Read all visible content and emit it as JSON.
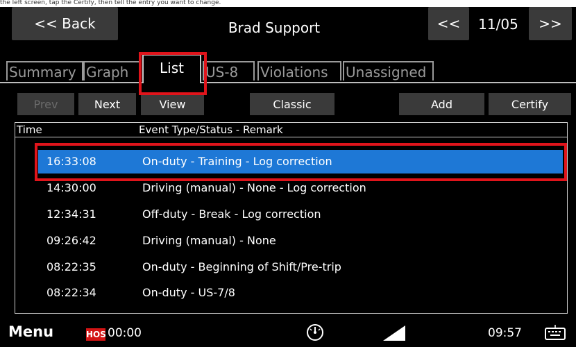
{
  "top_strip": {
    "text": "the left screen, tap the Certify, then tell the entry you want to change."
  },
  "header": {
    "back_label": "<< Back",
    "title": "Brad Support",
    "prev_day_label": "<<",
    "date": "11/05",
    "next_day_label": ">>"
  },
  "tabs": [
    {
      "label": "Summary",
      "active": false
    },
    {
      "label": "Graph",
      "active": false
    },
    {
      "label": "List",
      "active": true
    },
    {
      "label": "US-8",
      "active": false
    },
    {
      "label": "Violations",
      "active": false
    },
    {
      "label": "Unassigned",
      "active": false
    }
  ],
  "toolbar": {
    "prev_label": "Prev",
    "next_label": "Next",
    "view_label": "View",
    "classic_label": "Classic",
    "add_label": "Add",
    "certify_label": "Certify"
  },
  "list": {
    "columns": [
      "Time",
      "Event Type/Status - Remark"
    ],
    "rows": [
      {
        "time": "16:33:08",
        "event": "On-duty - Training - Log correction",
        "selected": true
      },
      {
        "time": "14:30:00",
        "event": "Driving (manual) - None - Log correction",
        "selected": false
      },
      {
        "time": "12:34:31",
        "event": "Off-duty - Break - Log correction",
        "selected": false
      },
      {
        "time": "09:26:42",
        "event": "Driving (manual) - None",
        "selected": false
      },
      {
        "time": "08:22:35",
        "event": "On-duty - Beginning of Shift/Pre-trip",
        "selected": false
      },
      {
        "time": "08:22:34",
        "event": "On-duty - US-7/8",
        "selected": false
      }
    ]
  },
  "status_bar": {
    "menu_label": "Menu",
    "hos_badge": "HOS",
    "hos_time": "00:00",
    "clock": "09:57",
    "icons": [
      "gauge-icon",
      "signal-icon",
      "keyboard-icon"
    ]
  },
  "colors": {
    "background": "#000000",
    "button": "#3a3a3a",
    "selected_row": "#1e78d6",
    "highlight_box": "#e0141b",
    "hos_badge": "#d31414"
  }
}
